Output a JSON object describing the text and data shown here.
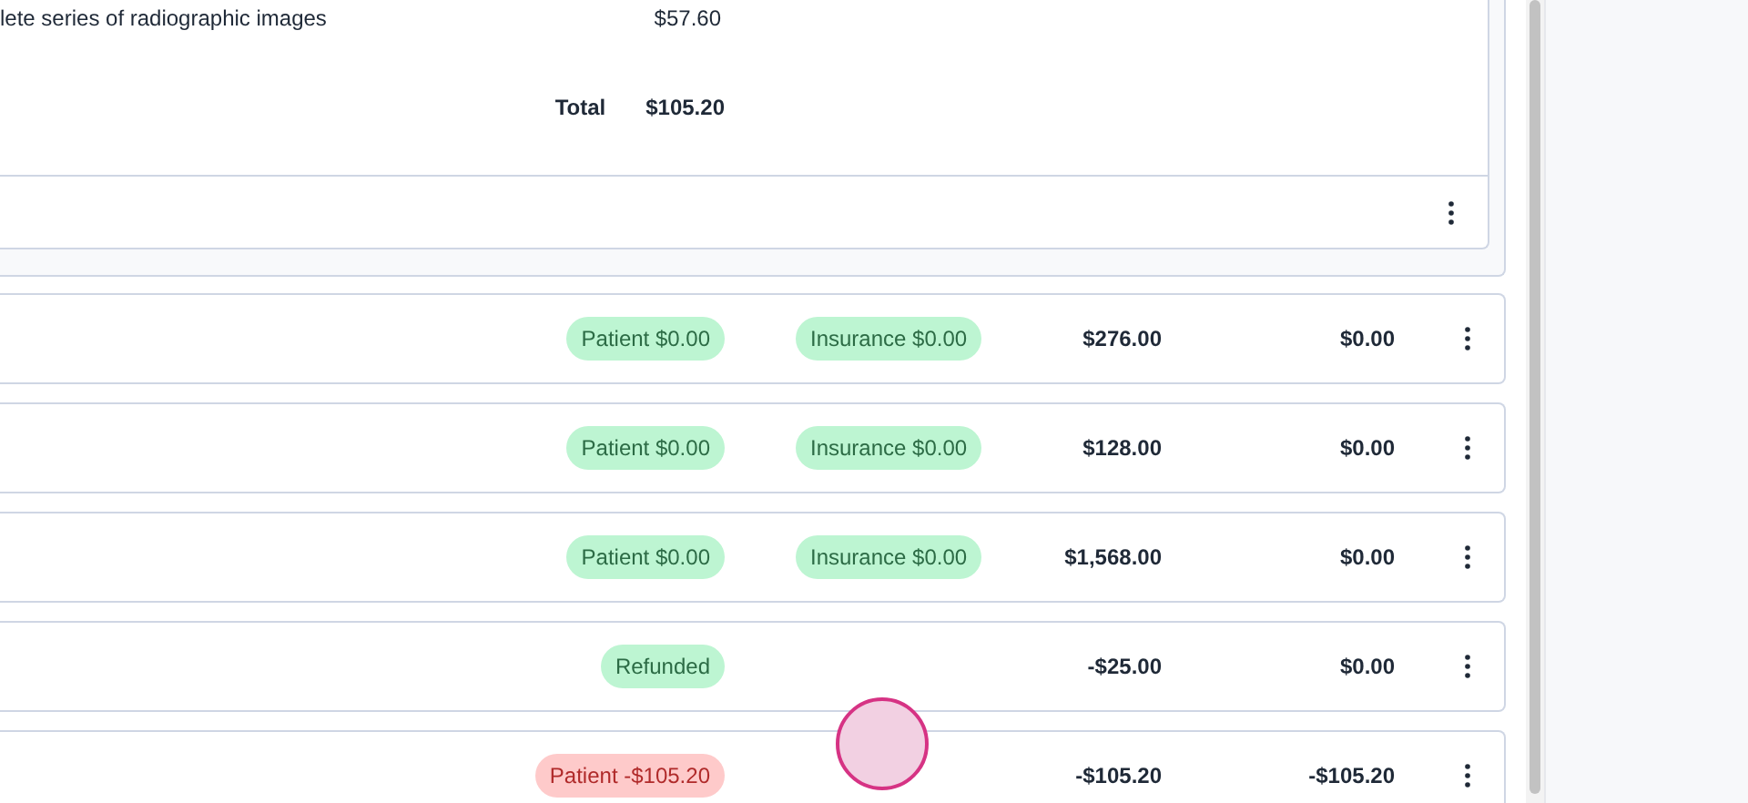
{
  "invoice": {
    "line_items": [
      {
        "description": "lete series of radiographic images",
        "amount": "$57.60"
      }
    ],
    "total": {
      "label": "Total",
      "value": "$105.20"
    }
  },
  "rows": [
    {
      "badges": [
        {
          "text": "Patient $0.00",
          "color": "#bdf5d2"
        },
        {
          "text": "Insurance $0.00",
          "color": "#bdf5d2"
        }
      ],
      "amount": "$276.00",
      "balance": "$0.00"
    },
    {
      "badges": [
        {
          "text": "Patient $0.00",
          "color": "#bdf5d2"
        },
        {
          "text": "Insurance $0.00",
          "color": "#bdf5d2"
        }
      ],
      "amount": "$128.00",
      "balance": "$0.00"
    },
    {
      "badges": [
        {
          "text": "Patient $0.00",
          "color": "#bdf5d2"
        },
        {
          "text": "Insurance $0.00",
          "color": "#bdf5d2"
        }
      ],
      "amount": "$1,568.00",
      "balance": "$0.00"
    },
    {
      "badges": [
        {
          "text": "Refunded",
          "color": "#bdf5d2"
        }
      ],
      "amount": "-$25.00",
      "balance": "$0.00"
    },
    {
      "badges": [
        {
          "text": "Patient -$105.20",
          "color": "#fecaca"
        }
      ],
      "amount": "-$105.20",
      "balance": "-$105.20"
    }
  ]
}
